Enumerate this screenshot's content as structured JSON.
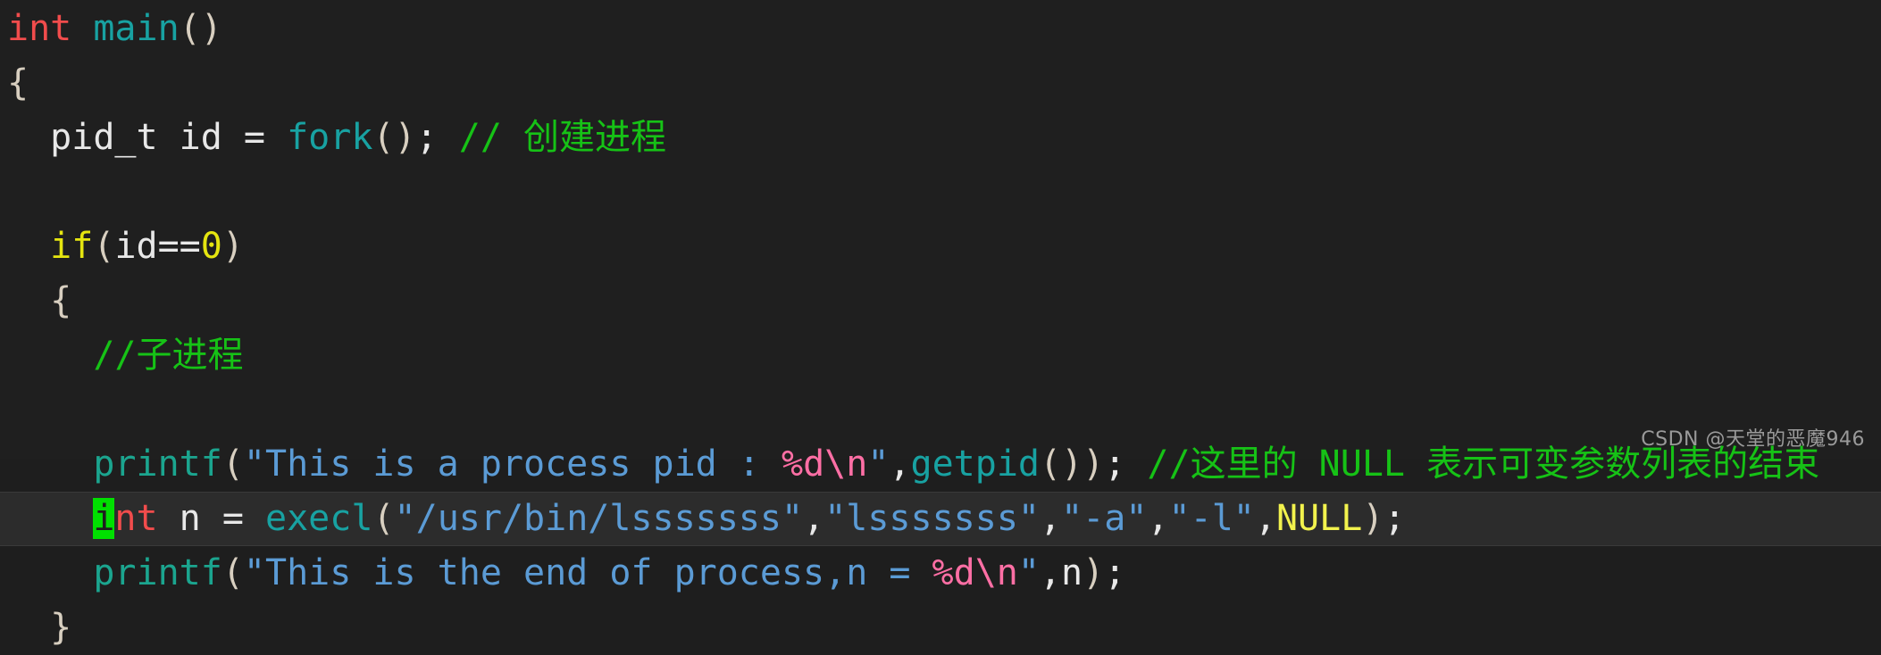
{
  "editor": {
    "background_color": "#1f1f1f",
    "highlight_line_color": "#2c2c2c",
    "cursor_color": "#00e000",
    "font_size_px": 40,
    "line_height_px": 61
  },
  "colors": {
    "keyword_type": "#f14c4c",
    "keyword_control": "#e5e510",
    "function": "#18a2a2",
    "function_printf": "#1ba58f",
    "plain_text": "#e8e8e8",
    "string": "#5b9bd5",
    "format_specifier": "#ff6fa5",
    "number": "#e5e510",
    "null_constant": "#f2f24d",
    "comment": "#16c216",
    "watermark": "#9a9a9a"
  },
  "code_lines": [
    {
      "id": "line-1",
      "text": "int main()",
      "tokens": [
        {
          "text": "int",
          "cls": "t-kw"
        },
        {
          "text": " ",
          "cls": "t-plain"
        },
        {
          "text": "main",
          "cls": "t-fn"
        },
        {
          "text": "()",
          "cls": "t-paren"
        }
      ]
    },
    {
      "id": "line-2",
      "text": "{",
      "tokens": [
        {
          "text": "{",
          "cls": "t-paren"
        }
      ]
    },
    {
      "id": "line-3",
      "text": "  pid_t id = fork(); // 创建进程",
      "tokens": [
        {
          "text": "  pid_t id = ",
          "cls": "t-plain"
        },
        {
          "text": "fork",
          "cls": "t-fn"
        },
        {
          "text": "()",
          "cls": "t-paren"
        },
        {
          "text": ";",
          "cls": "t-plain"
        },
        {
          "text": " ",
          "cls": "t-plain"
        },
        {
          "text": "// ",
          "cls": "t-comment"
        },
        {
          "text": "创建进程",
          "cls": "t-comment t-cn"
        }
      ]
    },
    {
      "id": "line-4",
      "text": "",
      "tokens": []
    },
    {
      "id": "line-5",
      "text": "  if(id==0)",
      "tokens": [
        {
          "text": "  ",
          "cls": "t-plain"
        },
        {
          "text": "if",
          "cls": "t-kw2"
        },
        {
          "text": "(",
          "cls": "t-paren"
        },
        {
          "text": "id==",
          "cls": "t-plain"
        },
        {
          "text": "0",
          "cls": "t-num"
        },
        {
          "text": ")",
          "cls": "t-paren"
        }
      ]
    },
    {
      "id": "line-6",
      "text": "  {",
      "tokens": [
        {
          "text": "  ",
          "cls": "t-plain"
        },
        {
          "text": "{",
          "cls": "t-paren"
        }
      ]
    },
    {
      "id": "line-7",
      "text": "    //子进程",
      "tokens": [
        {
          "text": "    ",
          "cls": "t-plain"
        },
        {
          "text": "//",
          "cls": "t-comment"
        },
        {
          "text": "子进程",
          "cls": "t-comment t-cn"
        }
      ]
    },
    {
      "id": "line-8",
      "text": "",
      "tokens": []
    },
    {
      "id": "line-9",
      "text": "    printf(\"This is a process pid : %d\\n\",getpid()); //这里的 NULL 表示可变参数列表的结束",
      "tokens": [
        {
          "text": "    ",
          "cls": "t-plain"
        },
        {
          "text": "printf",
          "cls": "t-fn2"
        },
        {
          "text": "(",
          "cls": "t-paren"
        },
        {
          "text": "\"This is a process pid : ",
          "cls": "t-str"
        },
        {
          "text": "%d\\n",
          "cls": "t-fmt"
        },
        {
          "text": "\"",
          "cls": "t-str"
        },
        {
          "text": ",",
          "cls": "t-plain"
        },
        {
          "text": "getpid",
          "cls": "t-fn"
        },
        {
          "text": "())",
          "cls": "t-paren"
        },
        {
          "text": "; ",
          "cls": "t-plain"
        },
        {
          "text": "//",
          "cls": "t-comment"
        },
        {
          "text": "这里的",
          "cls": "t-comment t-cn"
        },
        {
          "text": " NULL ",
          "cls": "t-comment"
        },
        {
          "text": "表示可变参数列表的结束",
          "cls": "t-comment t-cn"
        }
      ]
    },
    {
      "id": "line-10",
      "highlighted": true,
      "cursor_char": "i",
      "text": "    int n = execl(\"/usr/bin/lsssssss\",\"lsssssss\",\"-a\",\"-l\",NULL);",
      "tokens": [
        {
          "text": "    ",
          "cls": "t-plain"
        },
        {
          "text": "i",
          "cls": "t-kw cursor-block"
        },
        {
          "text": "nt",
          "cls": "t-kw"
        },
        {
          "text": " n = ",
          "cls": "t-plain"
        },
        {
          "text": "execl",
          "cls": "t-fn"
        },
        {
          "text": "(",
          "cls": "t-paren"
        },
        {
          "text": "\"/usr/bin/lsssssss\"",
          "cls": "t-str"
        },
        {
          "text": ",",
          "cls": "t-plain"
        },
        {
          "text": "\"lsssssss\"",
          "cls": "t-str"
        },
        {
          "text": ",",
          "cls": "t-plain"
        },
        {
          "text": "\"-a\"",
          "cls": "t-str"
        },
        {
          "text": ",",
          "cls": "t-plain"
        },
        {
          "text": "\"-l\"",
          "cls": "t-str"
        },
        {
          "text": ",",
          "cls": "t-plain"
        },
        {
          "text": "NULL",
          "cls": "t-null"
        },
        {
          "text": ")",
          "cls": "t-paren"
        },
        {
          "text": ";",
          "cls": "t-plain"
        }
      ]
    },
    {
      "id": "line-11",
      "text": "    printf(\"This is the end of process,n = %d\\n\",n);",
      "tokens": [
        {
          "text": "    ",
          "cls": "t-plain"
        },
        {
          "text": "printf",
          "cls": "t-fn2"
        },
        {
          "text": "(",
          "cls": "t-paren"
        },
        {
          "text": "\"This is the end of process,n = ",
          "cls": "t-str"
        },
        {
          "text": "%d\\n",
          "cls": "t-fmt"
        },
        {
          "text": "\"",
          "cls": "t-str"
        },
        {
          "text": ",n",
          "cls": "t-plain"
        },
        {
          "text": ")",
          "cls": "t-paren"
        },
        {
          "text": ";",
          "cls": "t-plain"
        }
      ]
    },
    {
      "id": "line-12",
      "text": "  }",
      "tokens": [
        {
          "text": "  ",
          "cls": "t-plain"
        },
        {
          "text": "}",
          "cls": "t-paren"
        }
      ]
    }
  ],
  "watermark": {
    "text": "CSDN @天堂的恶魔946"
  }
}
